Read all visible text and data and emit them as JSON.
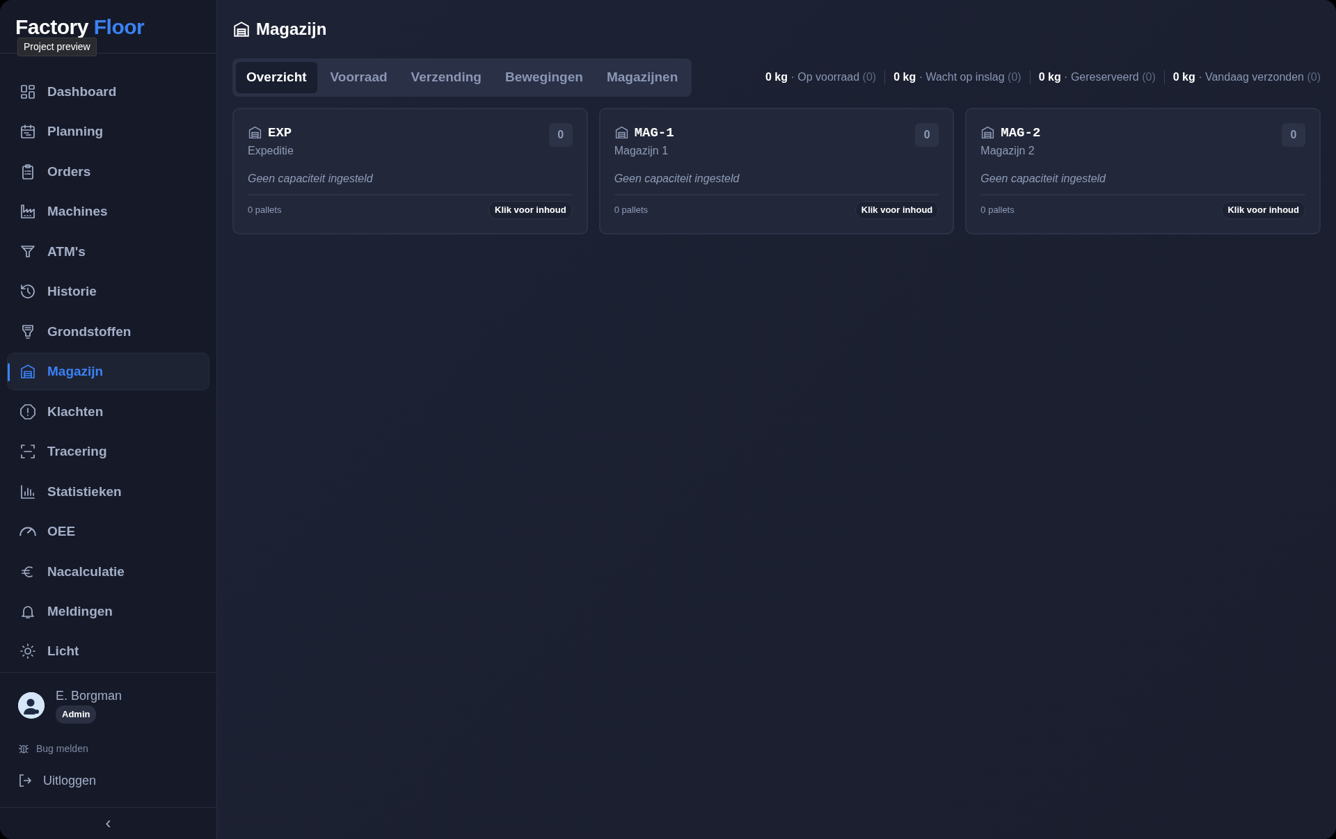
{
  "brand": {
    "first": "Factory",
    "second": "Floor",
    "tooltip": "Project preview"
  },
  "nav": [
    {
      "label": "Dashboard",
      "selected": false
    },
    {
      "label": "Planning",
      "selected": false
    },
    {
      "label": "Orders",
      "selected": false
    },
    {
      "label": "Machines",
      "selected": false
    },
    {
      "label": "ATM's",
      "selected": false
    },
    {
      "label": "Historie",
      "selected": false
    },
    {
      "label": "Grondstoffen",
      "selected": false
    },
    {
      "label": "Magazijn",
      "selected": true
    },
    {
      "label": "Klachten",
      "selected": false
    },
    {
      "label": "Tracering",
      "selected": false
    },
    {
      "label": "Statistieken",
      "selected": false
    },
    {
      "label": "OEE",
      "selected": false
    },
    {
      "label": "Nacalculatie",
      "selected": false
    }
  ],
  "extra_nav": [
    {
      "label": "Meldingen"
    },
    {
      "label": "Licht"
    }
  ],
  "user": {
    "name": "E. Borgman",
    "role": "Admin"
  },
  "bug_link": "Bug melden",
  "logout": "Uitloggen",
  "collapse": "‹",
  "page_title": "Magazijn",
  "tabs": [
    {
      "label": "Overzicht",
      "selected": true
    },
    {
      "label": "Voorraad",
      "selected": false
    },
    {
      "label": "Verzending",
      "selected": false
    },
    {
      "label": "Bewegingen",
      "selected": false
    },
    {
      "label": "Magazijnen",
      "selected": false
    }
  ],
  "stats": [
    {
      "value": "0 kg",
      "dot": "·",
      "label": "Op voorraad",
      "count": "(0)"
    },
    {
      "value": "0 kg",
      "dot": "·",
      "label": "Wacht op inslag",
      "count": "(0)"
    },
    {
      "value": "0 kg",
      "dot": "·",
      "label": "Gereserveerd",
      "count": "(0)"
    },
    {
      "value": "0 kg",
      "dot": "·",
      "label": "Vandaag verzonden",
      "count": "(0)"
    }
  ],
  "warehouses": [
    {
      "code": "EXP",
      "name": "Expeditie",
      "capacity": "Geen capaciteit ingesteld",
      "count": "0",
      "pallets": "0 pallets",
      "action": "Klik voor inhoud"
    },
    {
      "code": "MAG-1",
      "name": "Magazijn 1",
      "capacity": "Geen capaciteit ingesteld",
      "count": "0",
      "pallets": "0 pallets",
      "action": "Klik voor inhoud"
    },
    {
      "code": "MAG-2",
      "name": "Magazijn 2",
      "capacity": "Geen capaciteit ingesteld",
      "count": "0",
      "pallets": "0 pallets",
      "action": "Klik voor inhoud"
    }
  ]
}
